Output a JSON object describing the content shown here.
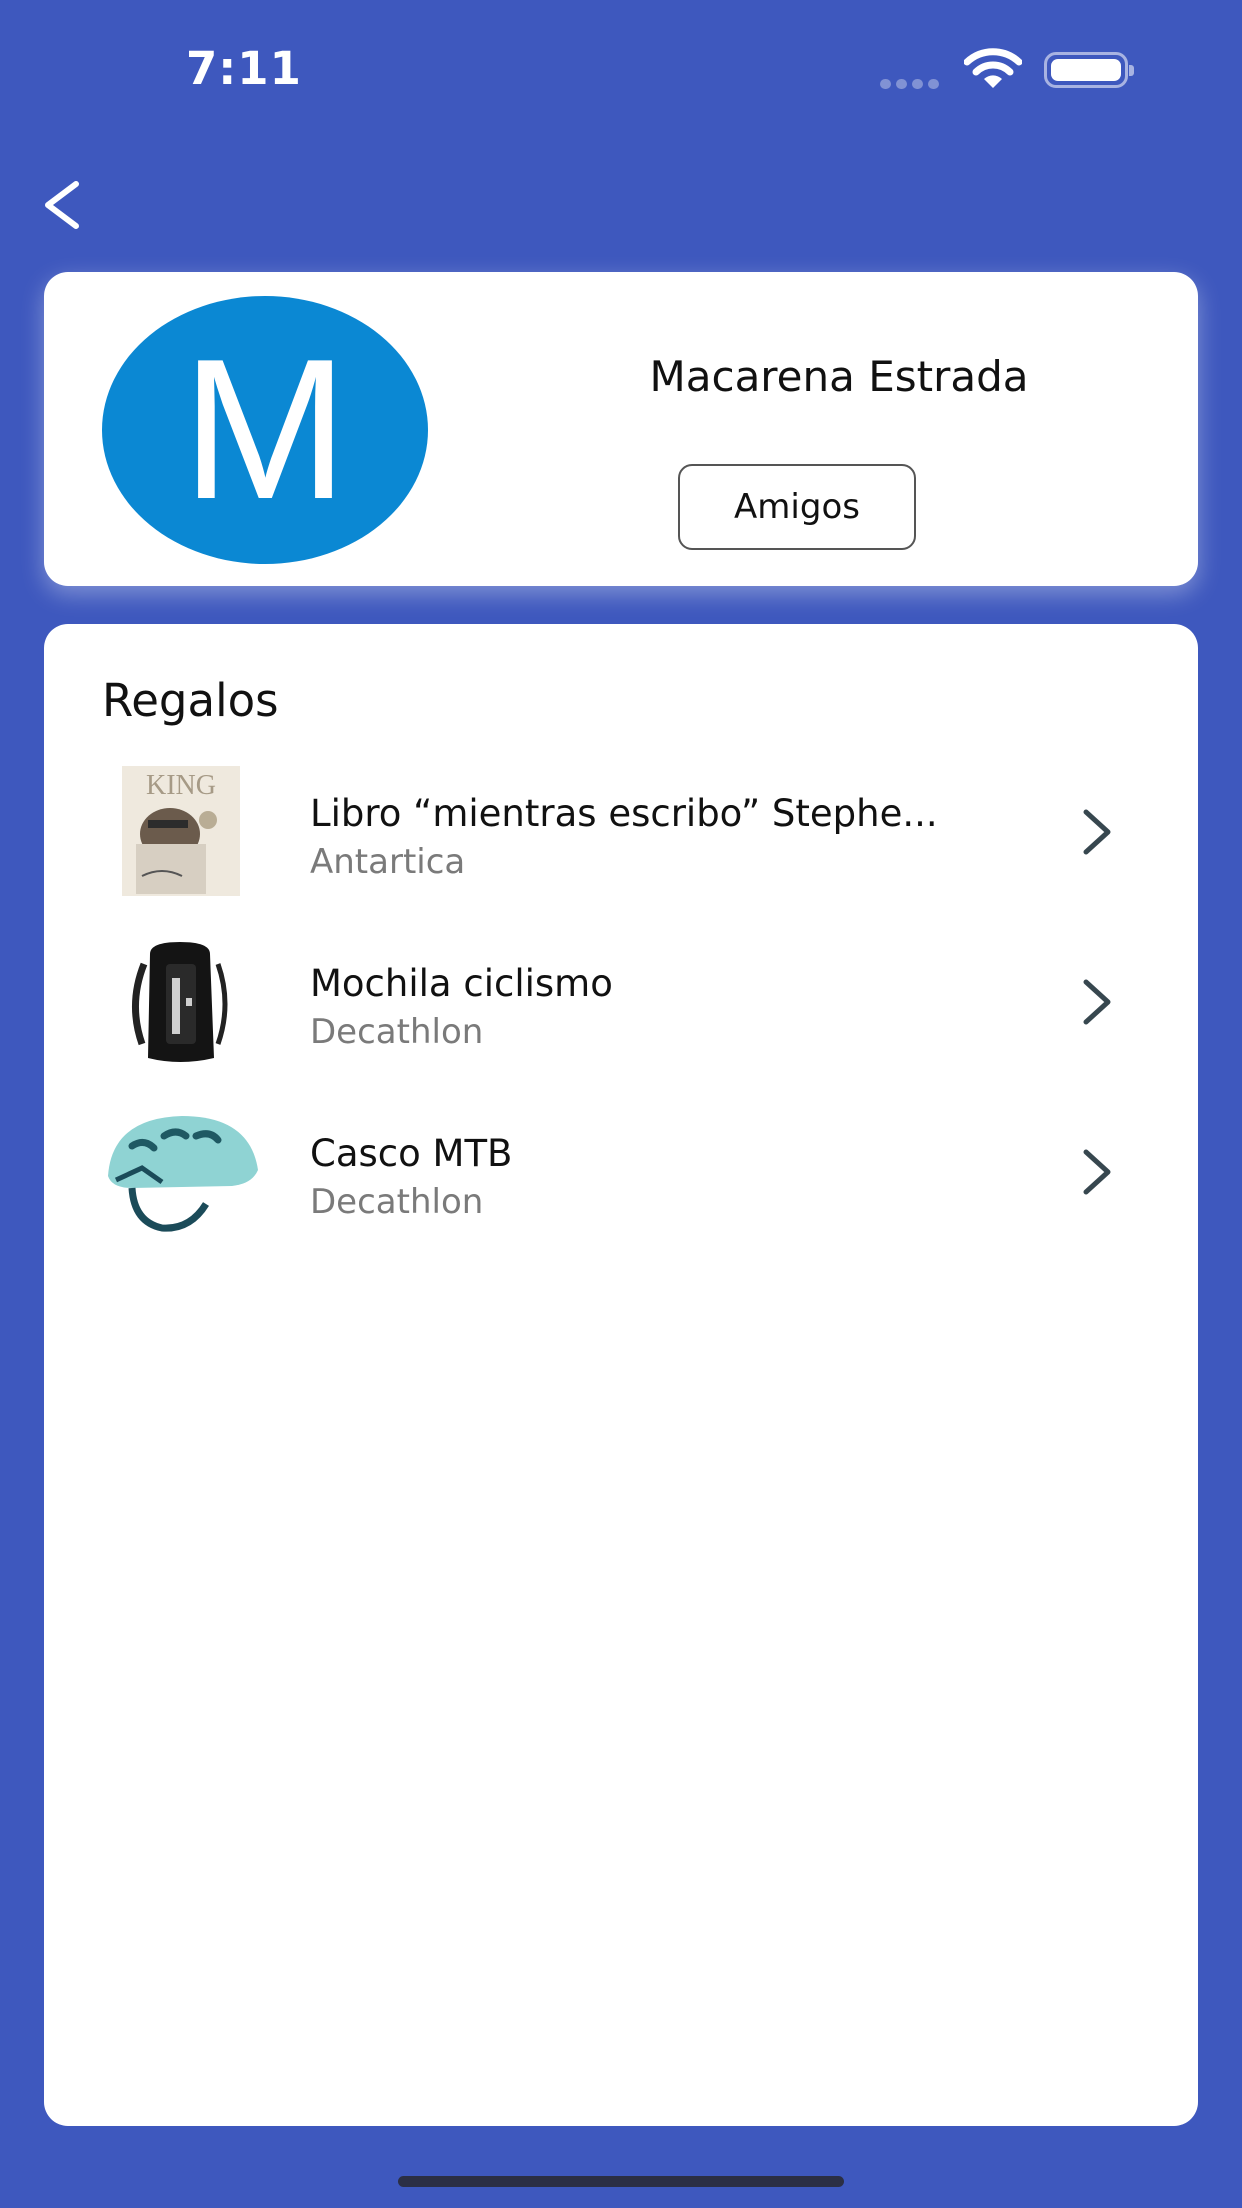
{
  "status_bar": {
    "time": "7:11"
  },
  "nav": {
    "back_icon": "chevron-left-icon"
  },
  "profile": {
    "avatar_letter": "M",
    "avatar_color": "#0b88d3",
    "name": "Macarena Estrada",
    "friends_button_label": "Amigos"
  },
  "gifts": {
    "title": "Regalos",
    "items": [
      {
        "name": "Libro “mientras escribo” Stephe...",
        "store": "Antartica",
        "thumbnail": "book-cover-image"
      },
      {
        "name": "Mochila ciclismo",
        "store": "Decathlon",
        "thumbnail": "backpack-image"
      },
      {
        "name": "Casco MTB",
        "store": "Decathlon",
        "thumbnail": "helmet-image"
      }
    ]
  },
  "colors": {
    "background": "#3e58be",
    "card": "#ffffff",
    "secondary_text": "#7a7a7a"
  }
}
